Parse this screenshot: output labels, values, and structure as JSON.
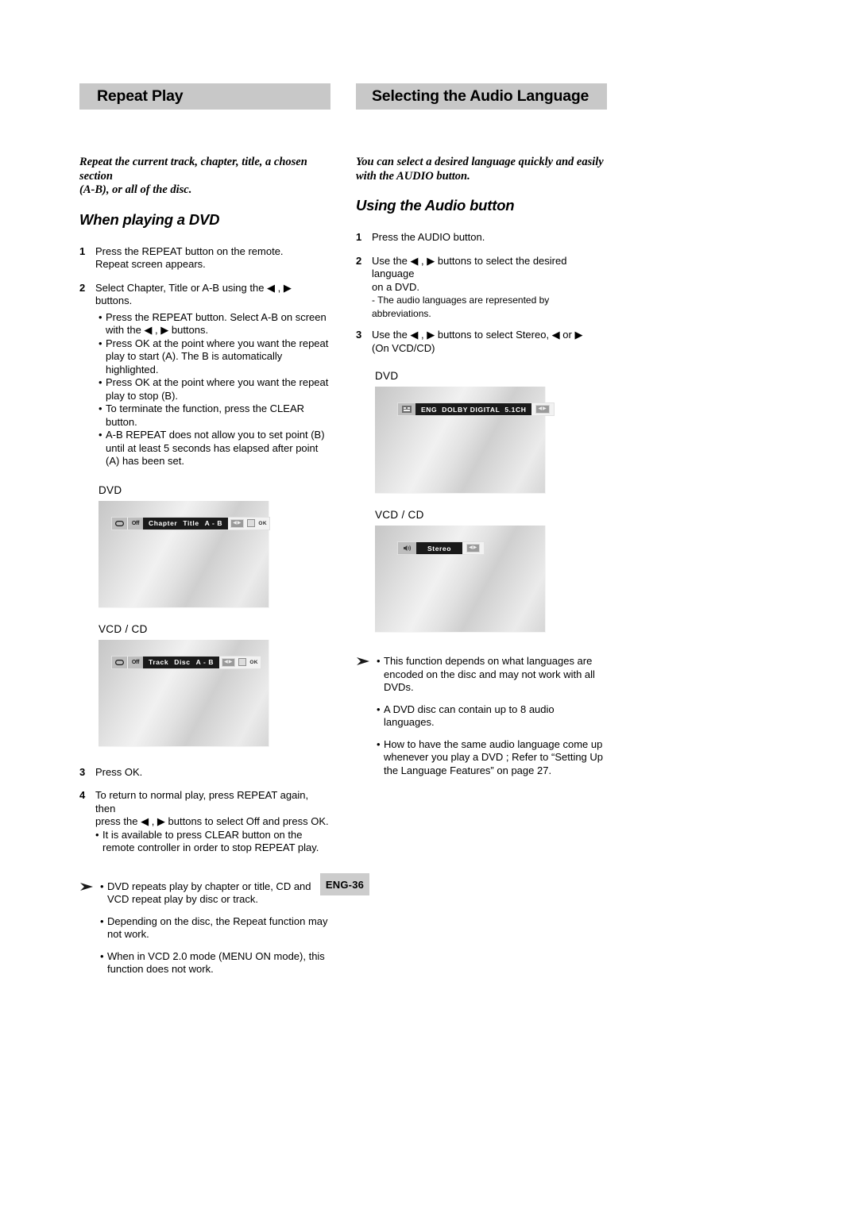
{
  "page": {
    "badge": "ENG-36"
  },
  "left": {
    "header": "Repeat Play",
    "intro_line1": "Repeat the current track, chapter, title, a chosen section",
    "intro_line2": "(A-B), or all of the disc.",
    "subhead": "When playing a DVD",
    "steps": [
      {
        "num": "1",
        "lines": [
          "Press the REPEAT button on the remote.",
          "Repeat screen appears."
        ]
      },
      {
        "num": "2",
        "lines": [
          "Select Chapter, Title or A-B using the ◀ , ▶ buttons."
        ]
      }
    ],
    "bullets": [
      "Press the REPEAT button. Select A-B on screen with the ◀ , ▶ buttons.",
      "Press OK at the point where you want the repeat play to start (A). The B is automatically highlighted.",
      "Press OK at the point where you want the repeat play to stop (B).",
      "To terminate the function, press the CLEAR button.",
      "A-B REPEAT does not allow you to set point (B) until at least 5 seconds has elapsed after point (A) has been set."
    ],
    "figures": [
      {
        "label": "DVD",
        "osd_items": [
          "Chapter",
          "Title",
          "A - B"
        ],
        "icons": [
          "repeat-icon",
          "off-icon"
        ],
        "tail_chip": "◀▶",
        "tail_ok": "OK"
      },
      {
        "label": "VCD / CD",
        "osd_items": [
          "Track",
          "Disc",
          "A - B"
        ],
        "icons": [
          "repeat-icon",
          "off-icon"
        ],
        "tail_chip": "◀▶",
        "tail_ok": "OK"
      }
    ],
    "steps2": [
      {
        "num": "3",
        "lines": [
          "Press OK."
        ]
      },
      {
        "num": "4",
        "lines": [
          "To return to normal play, press REPEAT again, then",
          "press the ◀ , ▶ buttons to select Off and press OK."
        ]
      }
    ],
    "step4_bullets": [
      "It is available to press CLEAR button on the remote controller in order to stop REPEAT play."
    ],
    "notes": [
      "DVD repeats play by chapter or title, CD and VCD repeat play by disc or track.",
      "Depending on the disc, the Repeat function may not work.",
      "When in VCD 2.0 mode (MENU ON mode), this function does not work."
    ]
  },
  "right": {
    "header": "Selecting the Audio Language",
    "intro_line1": "You can select a desired language quickly and easily",
    "intro_line2": "with the AUDIO button.",
    "subhead": "Using the Audio button",
    "steps": [
      {
        "num": "1",
        "lines": [
          "Press the AUDIO button."
        ]
      },
      {
        "num": "2",
        "lines": [
          "Use the ◀ , ▶ buttons to select the desired language",
          "on a DVD."
        ],
        "dash": "- The audio languages are represented by abbreviations."
      },
      {
        "num": "3",
        "lines": [
          "Use the ◀ , ▶ buttons to select Stereo, ◀ or ▶",
          "(On VCD/CD)"
        ]
      }
    ],
    "figures": [
      {
        "label": "DVD",
        "osd_items": [
          "ENG",
          "DOLBY DIGITAL",
          "5.1CH"
        ],
        "icons": [
          "audio-lang-icon"
        ],
        "tail_chip": "◀▶"
      },
      {
        "label": "VCD / CD",
        "osd_items": [
          "Stereo"
        ],
        "icons": [
          "speaker-icon"
        ],
        "tail_chip": "◀▶"
      }
    ],
    "notes": [
      "This function depends on what languages are encoded on the disc and may not work with all DVDs.",
      "A DVD disc can contain up to 8 audio languages.",
      "How to have the same audio language come up whenever you play a  DVD ;  Refer to “Setting Up the Language Features” on page 27."
    ]
  }
}
